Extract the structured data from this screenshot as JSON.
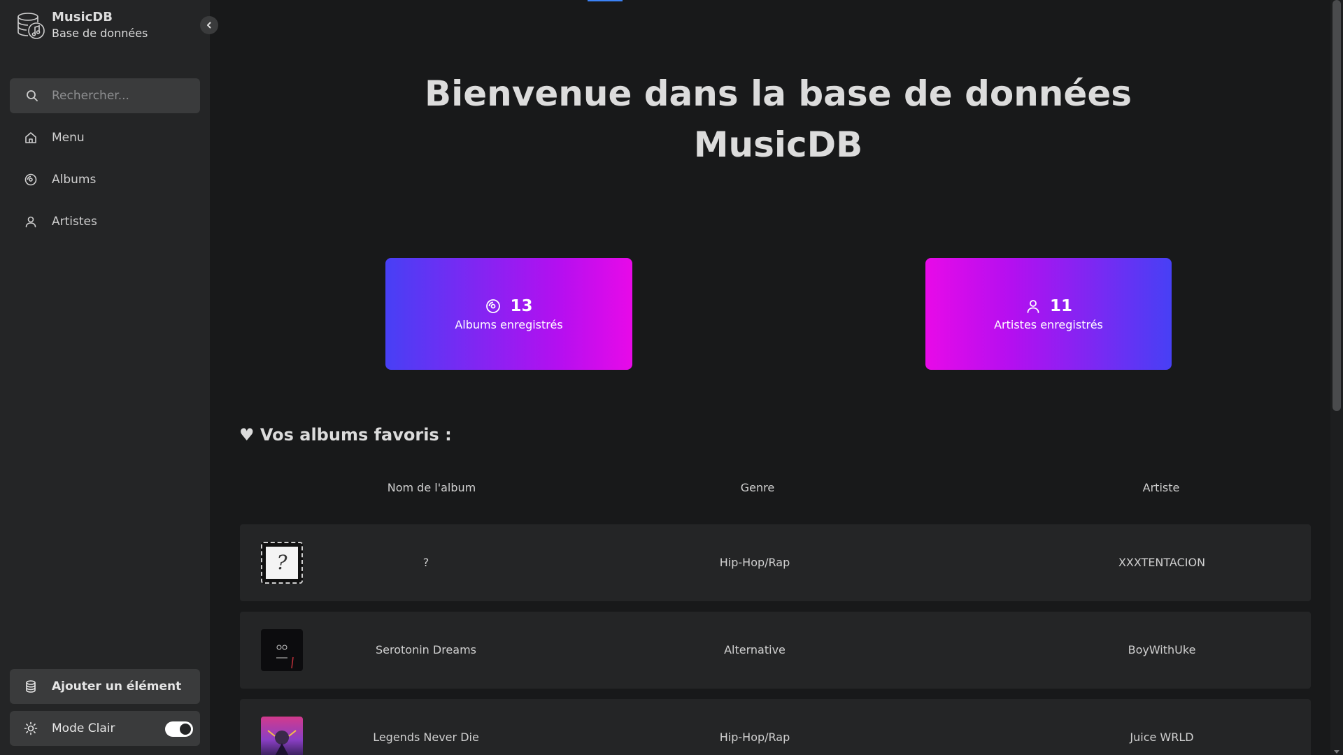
{
  "app": {
    "title": "MusicDB",
    "subtitle": "Base de données"
  },
  "search": {
    "placeholder": "Rechercher..."
  },
  "nav": {
    "items": [
      {
        "label": "Menu",
        "icon": "home-icon"
      },
      {
        "label": "Albums",
        "icon": "disc-icon"
      },
      {
        "label": "Artistes",
        "icon": "user-icon"
      }
    ]
  },
  "footer": {
    "add_label": "Ajouter un élément",
    "mode_label": "Mode Clair",
    "mode_toggle_on": true
  },
  "main": {
    "welcome_line1": "Bienvenue dans la base de données",
    "welcome_line2": "MusicDB",
    "stats": {
      "albums_count": "13",
      "albums_label": "Albums enregistrés",
      "artists_count": "11",
      "artists_label": "Artistes enregistrés"
    },
    "favorites_title": "♥ Vos albums favoris :",
    "table": {
      "headers": [
        "Nom de l'album",
        "Genre",
        "Artiste"
      ],
      "rows": [
        {
          "name": "?",
          "genre": "Hip-Hop/Rap",
          "artist": "XXXTENTACION"
        },
        {
          "name": "Serotonin Dreams",
          "genre": "Alternative",
          "artist": "BoyWithUke"
        },
        {
          "name": "Legends Never Die",
          "genre": "Hip-Hop/Rap",
          "artist": "Juice WRLD"
        }
      ]
    }
  },
  "colors": {
    "background": "#18191a",
    "sidebar": "#242526",
    "gradient_blue": "#4740f5",
    "gradient_magenta": "#e80ae8"
  }
}
